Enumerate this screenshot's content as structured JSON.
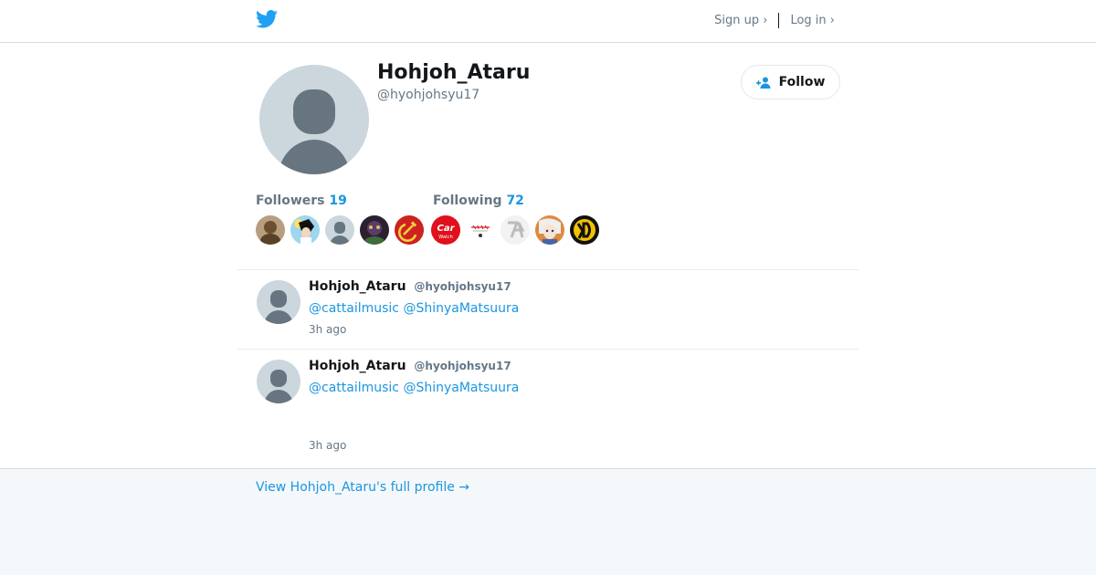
{
  "header": {
    "logo_icon": "twitter-bird-icon",
    "signup_label": "Sign up ›",
    "login_label": "Log in ›"
  },
  "profile": {
    "name": "Hohjoh_Ataru",
    "handle": "@hyohjohsyu17",
    "follow_label": "Follow",
    "follow_icon": "add-person-icon"
  },
  "counts": {
    "followers_label": "Followers",
    "followers_count": "19",
    "following_label": "Following",
    "following_count": "72"
  },
  "thumbnails": {
    "followers": [
      "avatar-brown",
      "avatar-anime",
      "avatar-default",
      "avatar-dark",
      "avatar-hammer-sickle"
    ],
    "following": [
      "avatar-car-watch",
      "avatar-text-logo",
      "avatar-grey-logo",
      "avatar-girl",
      "avatar-yellow-logo"
    ],
    "car_watch_top": "Car",
    "car_watch_bottom": "Watch"
  },
  "tweets": [
    {
      "name": "Hohjoh_Ataru",
      "handle": "@hyohjohsyu17",
      "mentions": [
        "@cattailmusic",
        "@ShinyaMatsuura"
      ],
      "time": "3h ago"
    },
    {
      "name": "Hohjoh_Ataru",
      "handle": "@hyohjohsyu17",
      "mentions": [
        "@cattailmusic",
        "@ShinyaMatsuura"
      ],
      "time": "3h ago"
    }
  ],
  "footer": {
    "full_profile_label": "View Hohjoh_Ataru's full profile →"
  },
  "colors": {
    "accent": "#1b95e0",
    "bird": "#1da1f2",
    "text": "#14171a",
    "muted": "#657786",
    "avatar_bg": "#ccd6dd",
    "avatar_fg": "#66757f"
  }
}
